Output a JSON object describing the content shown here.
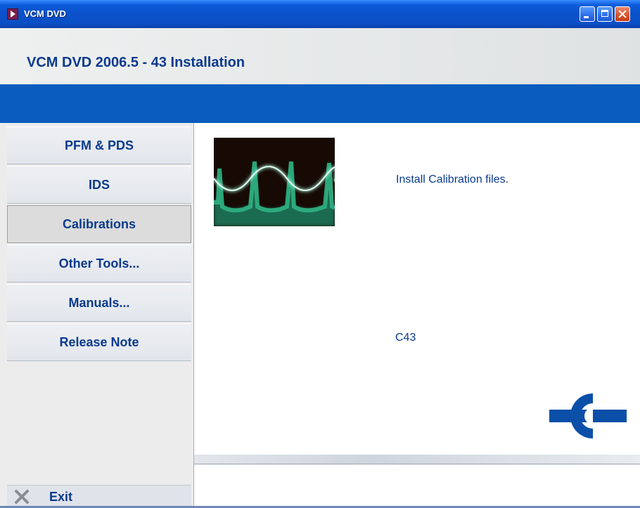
{
  "window": {
    "title": "VCM DVD",
    "controls": [
      "minimize",
      "maximize",
      "close"
    ]
  },
  "header": {
    "title": "VCM DVD 2006.5 - 43 Installation"
  },
  "sidebar": {
    "items": [
      {
        "label": "PFM & PDS",
        "active": false
      },
      {
        "label": "IDS",
        "active": false
      },
      {
        "label": "Calibrations",
        "active": true
      },
      {
        "label": "Other Tools...",
        "active": false
      },
      {
        "label": "Manuals...",
        "active": false
      },
      {
        "label": "Release Note",
        "active": false
      }
    ],
    "exit_label": "Exit"
  },
  "content": {
    "image_icon": "oscilloscope-waveform-image",
    "description": "Install Calibration files.",
    "code": "C43",
    "logo_icon": "ford-vcm-logo"
  },
  "colors": {
    "accent": "#0b5cbf",
    "text_blue": "#0a3a8c",
    "titlebar": "#0a50c8",
    "waveform": "#3cc69a"
  }
}
